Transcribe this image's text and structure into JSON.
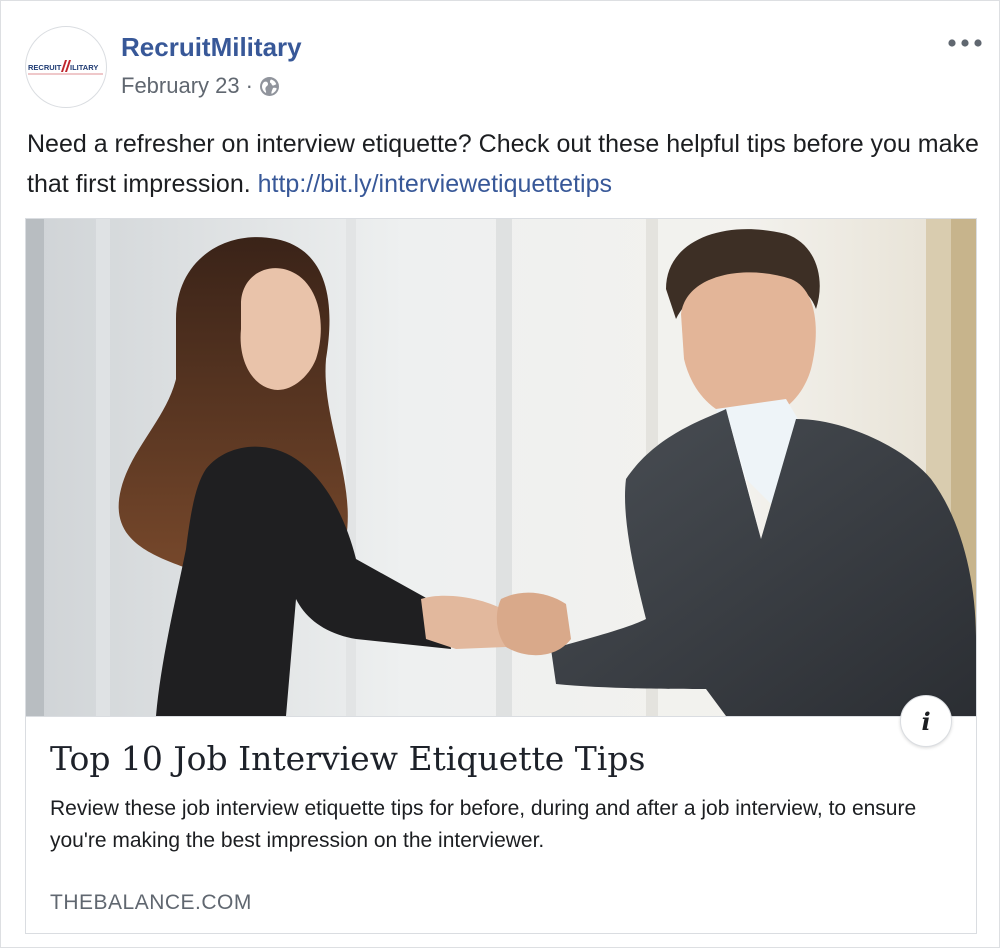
{
  "post": {
    "author": "RecruitMilitary",
    "date": "February 23",
    "separator": "·",
    "privacy_icon": "globe-icon",
    "more_icon": "more-options-icon",
    "text": "Need a refresher on interview etiquette? Check out these helpful tips before you make that first impression. ",
    "link_text": "http://bit.ly/interviewetiquettetips"
  },
  "avatar": {
    "logo_text": "RECRUIT MILITARY"
  },
  "link_card": {
    "image_description": "Handshake photo",
    "info_icon": "i",
    "title": "Top 10 Job Interview Etiquette Tips",
    "description": "Review these job interview etiquette tips for before, during and after a job interview, to ensure you're making the best impression on the interviewer.",
    "domain": "THEBALANCE.COM"
  },
  "colors": {
    "link": "#385898",
    "meta": "#606770",
    "text": "#1c1e21",
    "border": "#dadde1"
  }
}
